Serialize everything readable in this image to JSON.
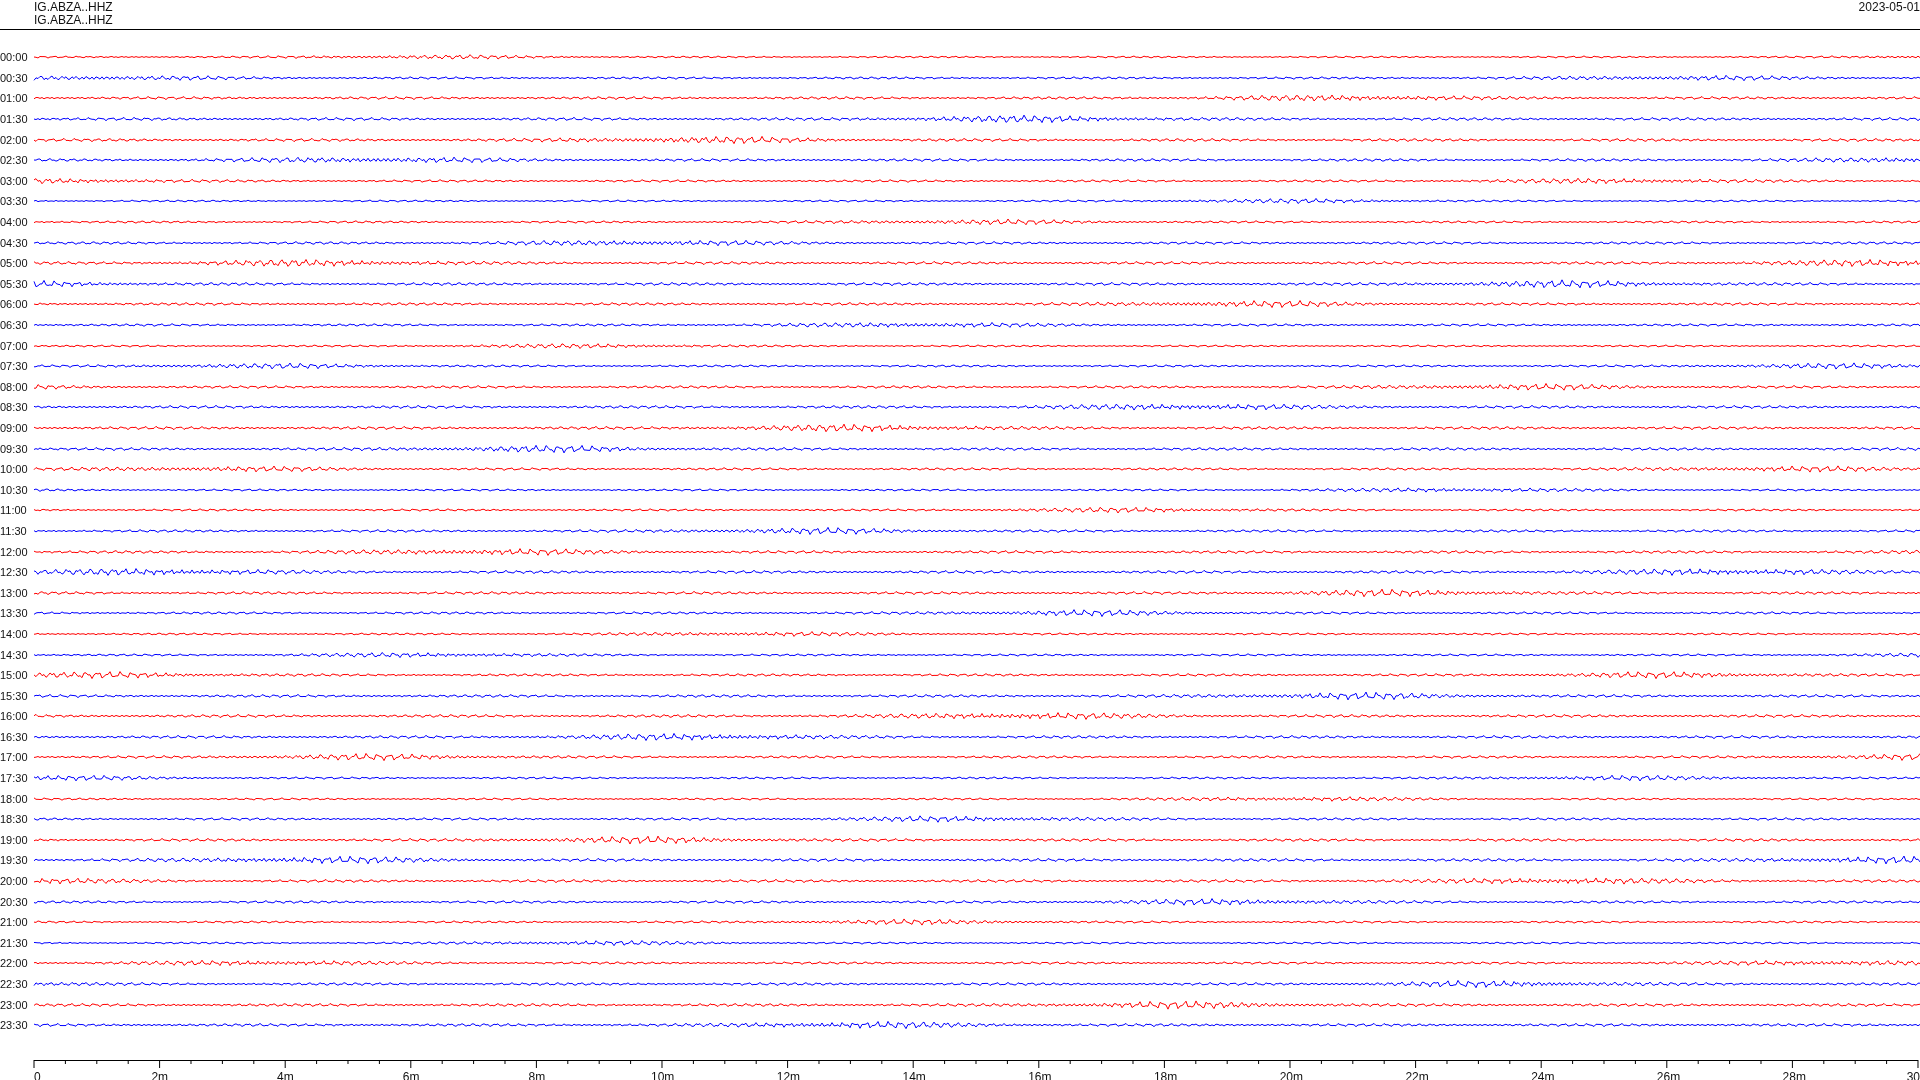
{
  "header": {
    "channel_lines": [
      "IG.ABZA..HHZ",
      "IG.ABZA..HHZ"
    ],
    "date": "2023-05-01"
  },
  "rows": [
    {
      "label": "00:00",
      "color": "#ff0000"
    },
    {
      "label": "00:30",
      "color": "#0000ff"
    },
    {
      "label": "01:00",
      "color": "#ff0000"
    },
    {
      "label": "01:30",
      "color": "#0000ff"
    },
    {
      "label": "02:00",
      "color": "#ff0000"
    },
    {
      "label": "02:30",
      "color": "#0000ff"
    },
    {
      "label": "03:00",
      "color": "#ff0000"
    },
    {
      "label": "03:30",
      "color": "#0000ff"
    },
    {
      "label": "04:00",
      "color": "#ff0000"
    },
    {
      "label": "04:30",
      "color": "#0000ff"
    },
    {
      "label": "05:00",
      "color": "#ff0000"
    },
    {
      "label": "05:30",
      "color": "#0000ff"
    },
    {
      "label": "06:00",
      "color": "#ff0000"
    },
    {
      "label": "06:30",
      "color": "#0000ff"
    },
    {
      "label": "07:00",
      "color": "#ff0000"
    },
    {
      "label": "07:30",
      "color": "#0000ff"
    },
    {
      "label": "08:00",
      "color": "#ff0000"
    },
    {
      "label": "08:30",
      "color": "#0000ff"
    },
    {
      "label": "09:00",
      "color": "#ff0000"
    },
    {
      "label": "09:30",
      "color": "#0000ff"
    },
    {
      "label": "10:00",
      "color": "#ff0000"
    },
    {
      "label": "10:30",
      "color": "#0000ff"
    },
    {
      "label": "11:00",
      "color": "#ff0000"
    },
    {
      "label": "11:30",
      "color": "#0000ff"
    },
    {
      "label": "12:00",
      "color": "#ff0000"
    },
    {
      "label": "12:30",
      "color": "#0000ff"
    },
    {
      "label": "13:00",
      "color": "#ff0000"
    },
    {
      "label": "13:30",
      "color": "#0000ff"
    },
    {
      "label": "14:00",
      "color": "#ff0000"
    },
    {
      "label": "14:30",
      "color": "#0000ff"
    },
    {
      "label": "15:00",
      "color": "#ff0000"
    },
    {
      "label": "15:30",
      "color": "#0000ff"
    },
    {
      "label": "16:00",
      "color": "#ff0000"
    },
    {
      "label": "16:30",
      "color": "#0000ff"
    },
    {
      "label": "17:00",
      "color": "#ff0000"
    },
    {
      "label": "17:30",
      "color": "#0000ff"
    },
    {
      "label": "18:00",
      "color": "#ff0000"
    },
    {
      "label": "18:30",
      "color": "#0000ff"
    },
    {
      "label": "19:00",
      "color": "#ff0000"
    },
    {
      "label": "19:30",
      "color": "#0000ff"
    },
    {
      "label": "20:00",
      "color": "#ff0000"
    },
    {
      "label": "20:30",
      "color": "#0000ff"
    },
    {
      "label": "21:00",
      "color": "#ff0000"
    },
    {
      "label": "21:30",
      "color": "#0000ff"
    },
    {
      "label": "22:00",
      "color": "#ff0000"
    },
    {
      "label": "22:30",
      "color": "#0000ff"
    },
    {
      "label": "23:00",
      "color": "#ff0000"
    },
    {
      "label": "23:30",
      "color": "#0000ff"
    }
  ],
  "axis": {
    "tick_labels": [
      "0",
      "2m",
      "4m",
      "6m",
      "8m",
      "10m",
      "12m",
      "14m",
      "16m",
      "18m",
      "20m",
      "22m",
      "24m",
      "26m",
      "28m",
      "30"
    ]
  }
}
